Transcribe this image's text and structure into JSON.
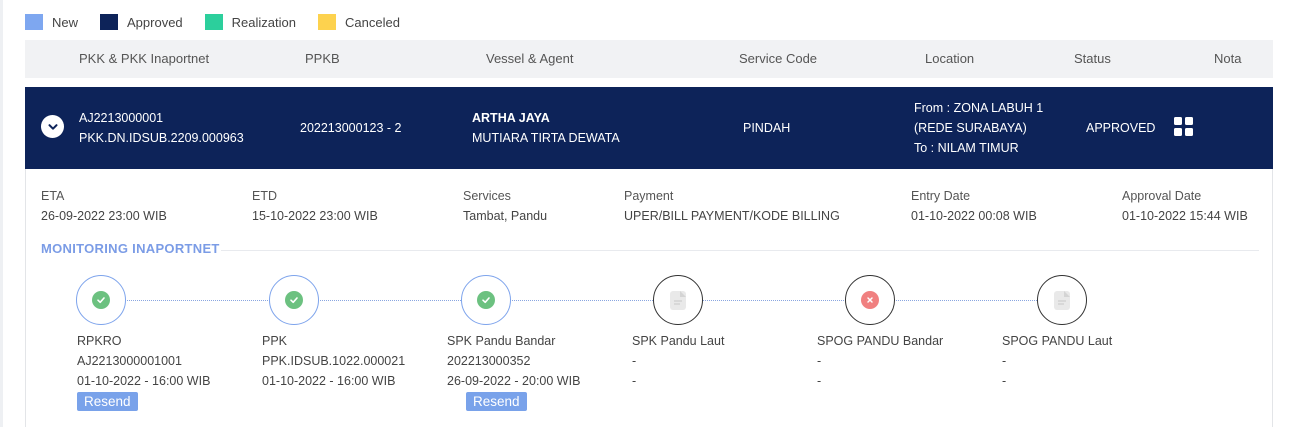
{
  "legend": [
    {
      "label": "New",
      "color": "#7ea7f0"
    },
    {
      "label": "Approved",
      "color": "#0d2359"
    },
    {
      "label": "Realization",
      "color": "#2ccf9c"
    },
    {
      "label": "Canceled",
      "color": "#fdd24e"
    }
  ],
  "table": {
    "headers": [
      "PKK & PKK Inaportnet",
      "PPKB",
      "Vessel & Agent",
      "Service Code",
      "Location",
      "Status",
      "Nota"
    ]
  },
  "row": {
    "pkk": "AJ2213000001",
    "pkk_inaportnet": "PKK.DN.IDSUB.2209.000963",
    "ppkb": "202213000123 - 2",
    "vessel": "ARTHA JAYA",
    "agent": "MUTIARA TIRTA DEWATA",
    "service_code": "PINDAH",
    "location_from_1": "From : ZONA LABUH 1",
    "location_from_2": "(REDE SURABAYA)",
    "location_to": "To : NILAM TIMUR",
    "status": "APPROVED",
    "status_color": "#0d2359"
  },
  "details": [
    {
      "label": "ETA",
      "value": "26-09-2022 23:00 WIB"
    },
    {
      "label": "ETD",
      "value": "15-10-2022 23:00 WIB"
    },
    {
      "label": "Services",
      "value": "Tambat, Pandu"
    },
    {
      "label": "Payment",
      "value": "UPER/BILL PAYMENT/KODE BILLING"
    },
    {
      "label": "Entry Date",
      "value": "01-10-2022 00:08 WIB"
    },
    {
      "label": "Approval Date",
      "value": "01-10-2022 15:44 WIB"
    }
  ],
  "monitoring": {
    "title": "MONITORING INAPORTNET",
    "stages": [
      {
        "name": "RPKRO",
        "number": "AJ2213000001001",
        "date": "01-10-2022 - 16:00 WIB",
        "state": "success",
        "action": "Resend"
      },
      {
        "name": "PPK",
        "number": "PPK.IDSUB.1022.000021",
        "date": "01-10-2022 - 16:00 WIB",
        "state": "success",
        "action": ""
      },
      {
        "name": "SPK Pandu Bandar",
        "number": "202213000352",
        "date": "26-09-2022 - 20:00 WIB",
        "state": "success",
        "action": "Resend"
      },
      {
        "name": "SPK Pandu Laut",
        "number": "-",
        "date": "-",
        "state": "pending",
        "action": ""
      },
      {
        "name": "SPOG PANDU Bandar",
        "number": "-",
        "date": "-",
        "state": "failed",
        "action": ""
      },
      {
        "name": "SPOG PANDU Laut",
        "number": "-",
        "date": "-",
        "state": "pending",
        "action": ""
      }
    ]
  },
  "icons": {
    "expand": "chevron-down-icon",
    "nota": "grid-icon",
    "success": "check-circle-icon",
    "failed": "close-circle-icon",
    "pending": "document-icon"
  }
}
